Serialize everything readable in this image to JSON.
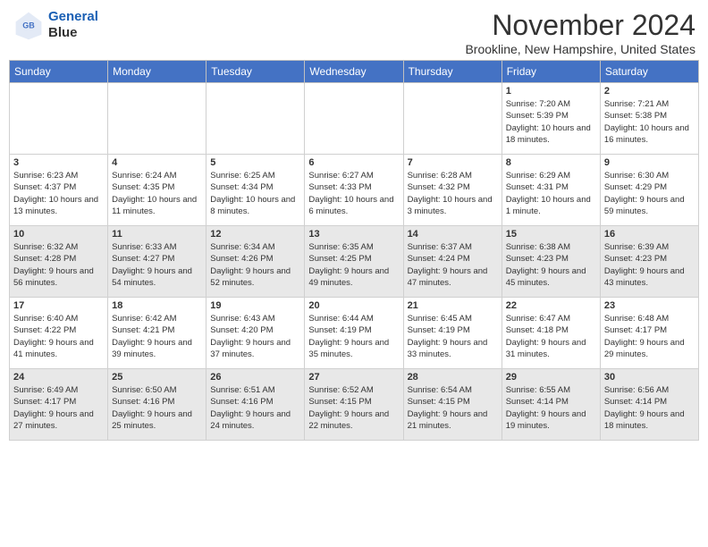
{
  "header": {
    "logo_line1": "General",
    "logo_line2": "Blue",
    "month_title": "November 2024",
    "location": "Brookline, New Hampshire, United States"
  },
  "days_of_week": [
    "Sunday",
    "Monday",
    "Tuesday",
    "Wednesday",
    "Thursday",
    "Friday",
    "Saturday"
  ],
  "weeks": [
    [
      {
        "day": "",
        "info": ""
      },
      {
        "day": "",
        "info": ""
      },
      {
        "day": "",
        "info": ""
      },
      {
        "day": "",
        "info": ""
      },
      {
        "day": "",
        "info": ""
      },
      {
        "day": "1",
        "info": "Sunrise: 7:20 AM\nSunset: 5:39 PM\nDaylight: 10 hours and 18 minutes."
      },
      {
        "day": "2",
        "info": "Sunrise: 7:21 AM\nSunset: 5:38 PM\nDaylight: 10 hours and 16 minutes."
      }
    ],
    [
      {
        "day": "3",
        "info": "Sunrise: 6:23 AM\nSunset: 4:37 PM\nDaylight: 10 hours and 13 minutes."
      },
      {
        "day": "4",
        "info": "Sunrise: 6:24 AM\nSunset: 4:35 PM\nDaylight: 10 hours and 11 minutes."
      },
      {
        "day": "5",
        "info": "Sunrise: 6:25 AM\nSunset: 4:34 PM\nDaylight: 10 hours and 8 minutes."
      },
      {
        "day": "6",
        "info": "Sunrise: 6:27 AM\nSunset: 4:33 PM\nDaylight: 10 hours and 6 minutes."
      },
      {
        "day": "7",
        "info": "Sunrise: 6:28 AM\nSunset: 4:32 PM\nDaylight: 10 hours and 3 minutes."
      },
      {
        "day": "8",
        "info": "Sunrise: 6:29 AM\nSunset: 4:31 PM\nDaylight: 10 hours and 1 minute."
      },
      {
        "day": "9",
        "info": "Sunrise: 6:30 AM\nSunset: 4:29 PM\nDaylight: 9 hours and 59 minutes."
      }
    ],
    [
      {
        "day": "10",
        "info": "Sunrise: 6:32 AM\nSunset: 4:28 PM\nDaylight: 9 hours and 56 minutes."
      },
      {
        "day": "11",
        "info": "Sunrise: 6:33 AM\nSunset: 4:27 PM\nDaylight: 9 hours and 54 minutes."
      },
      {
        "day": "12",
        "info": "Sunrise: 6:34 AM\nSunset: 4:26 PM\nDaylight: 9 hours and 52 minutes."
      },
      {
        "day": "13",
        "info": "Sunrise: 6:35 AM\nSunset: 4:25 PM\nDaylight: 9 hours and 49 minutes."
      },
      {
        "day": "14",
        "info": "Sunrise: 6:37 AM\nSunset: 4:24 PM\nDaylight: 9 hours and 47 minutes."
      },
      {
        "day": "15",
        "info": "Sunrise: 6:38 AM\nSunset: 4:23 PM\nDaylight: 9 hours and 45 minutes."
      },
      {
        "day": "16",
        "info": "Sunrise: 6:39 AM\nSunset: 4:23 PM\nDaylight: 9 hours and 43 minutes."
      }
    ],
    [
      {
        "day": "17",
        "info": "Sunrise: 6:40 AM\nSunset: 4:22 PM\nDaylight: 9 hours and 41 minutes."
      },
      {
        "day": "18",
        "info": "Sunrise: 6:42 AM\nSunset: 4:21 PM\nDaylight: 9 hours and 39 minutes."
      },
      {
        "day": "19",
        "info": "Sunrise: 6:43 AM\nSunset: 4:20 PM\nDaylight: 9 hours and 37 minutes."
      },
      {
        "day": "20",
        "info": "Sunrise: 6:44 AM\nSunset: 4:19 PM\nDaylight: 9 hours and 35 minutes."
      },
      {
        "day": "21",
        "info": "Sunrise: 6:45 AM\nSunset: 4:19 PM\nDaylight: 9 hours and 33 minutes."
      },
      {
        "day": "22",
        "info": "Sunrise: 6:47 AM\nSunset: 4:18 PM\nDaylight: 9 hours and 31 minutes."
      },
      {
        "day": "23",
        "info": "Sunrise: 6:48 AM\nSunset: 4:17 PM\nDaylight: 9 hours and 29 minutes."
      }
    ],
    [
      {
        "day": "24",
        "info": "Sunrise: 6:49 AM\nSunset: 4:17 PM\nDaylight: 9 hours and 27 minutes."
      },
      {
        "day": "25",
        "info": "Sunrise: 6:50 AM\nSunset: 4:16 PM\nDaylight: 9 hours and 25 minutes."
      },
      {
        "day": "26",
        "info": "Sunrise: 6:51 AM\nSunset: 4:16 PM\nDaylight: 9 hours and 24 minutes."
      },
      {
        "day": "27",
        "info": "Sunrise: 6:52 AM\nSunset: 4:15 PM\nDaylight: 9 hours and 22 minutes."
      },
      {
        "day": "28",
        "info": "Sunrise: 6:54 AM\nSunset: 4:15 PM\nDaylight: 9 hours and 21 minutes."
      },
      {
        "day": "29",
        "info": "Sunrise: 6:55 AM\nSunset: 4:14 PM\nDaylight: 9 hours and 19 minutes."
      },
      {
        "day": "30",
        "info": "Sunrise: 6:56 AM\nSunset: 4:14 PM\nDaylight: 9 hours and 18 minutes."
      }
    ]
  ]
}
